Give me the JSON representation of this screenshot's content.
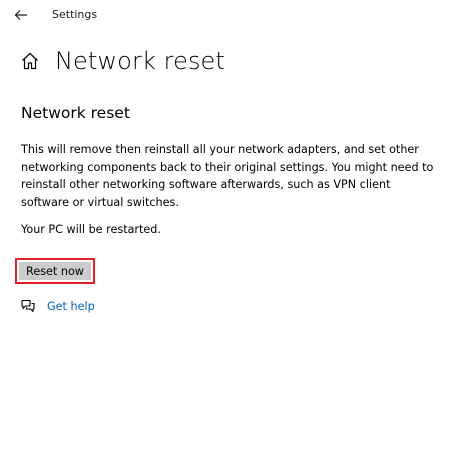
{
  "window": {
    "app_title": "Settings"
  },
  "header": {
    "title": "Network reset",
    "home_icon": "home-icon",
    "back_icon": "back-arrow-icon"
  },
  "section": {
    "title": "Network reset",
    "description": "This will remove then reinstall all your network adapters, and set other networking components back to their original settings. You might need to reinstall other networking software afterwards, such as VPN client software or virtual switches.",
    "restart_note": "Your PC will be restarted."
  },
  "actions": {
    "reset_label": "Reset now",
    "highlight_color": "#e0202c",
    "button_color": "#cccccc"
  },
  "help": {
    "label": "Get help",
    "icon": "chat-help-icon",
    "link_color": "#0067b8"
  }
}
